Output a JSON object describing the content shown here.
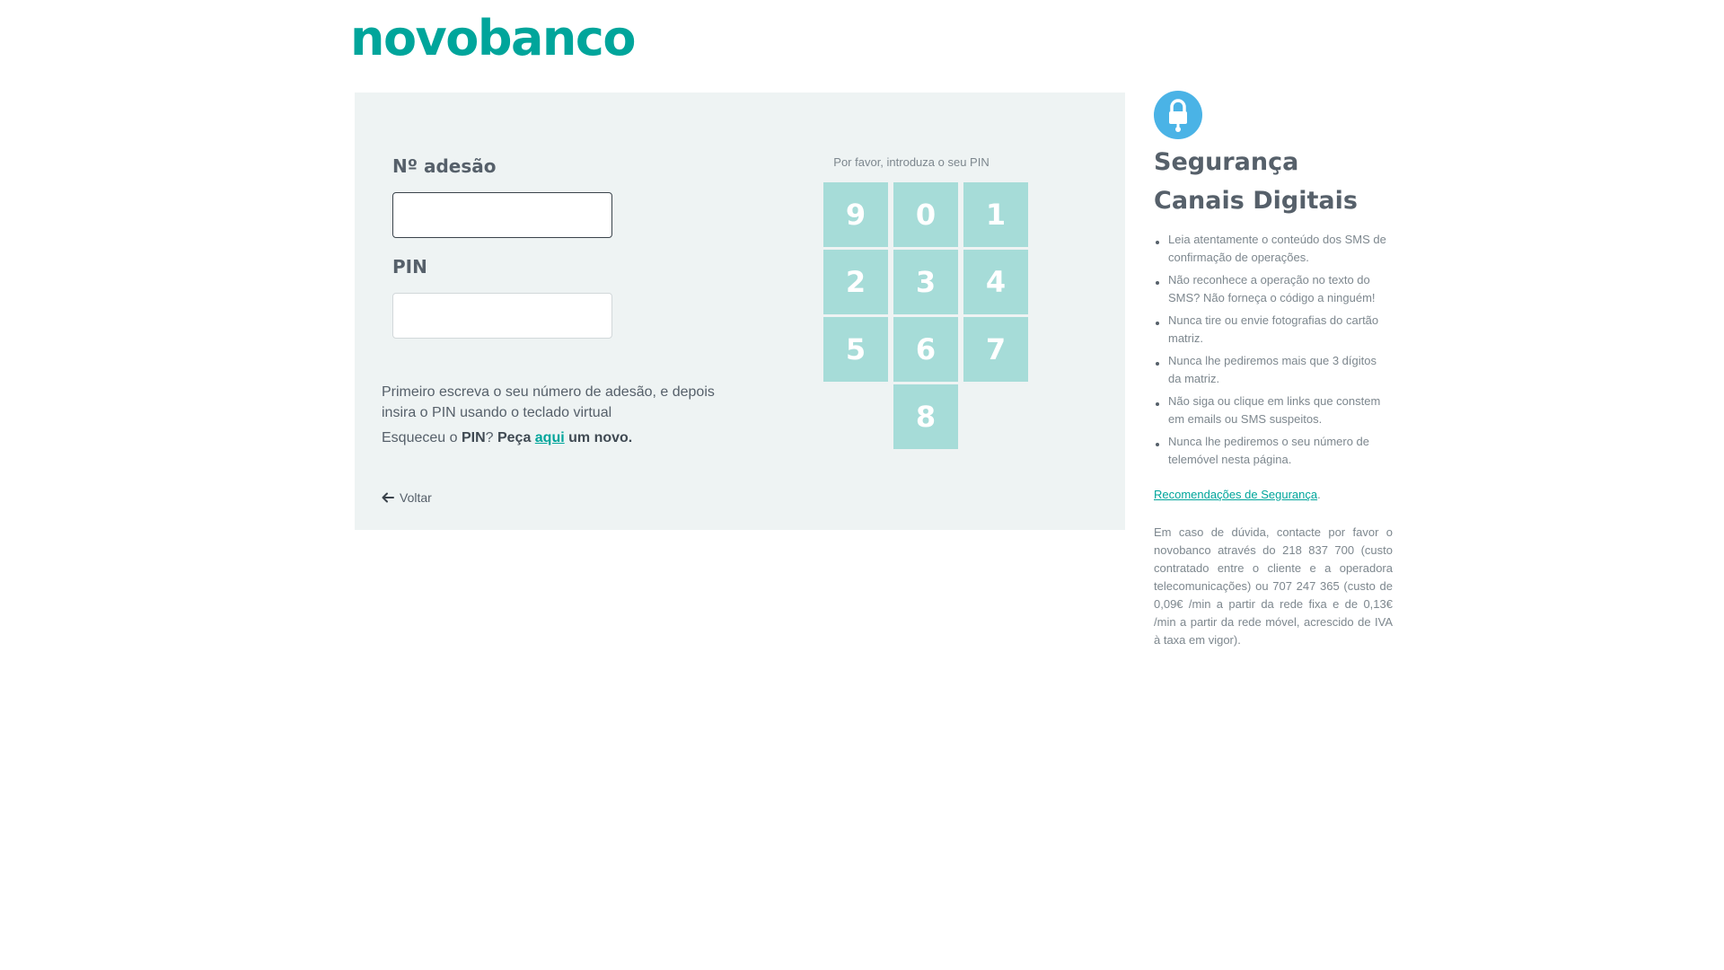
{
  "brand": {
    "logo_text": "novobanco",
    "accent_color": "#00a59b",
    "keypad_color": "#a6dcd8",
    "badge_color": "#4ab3e6",
    "panel_bg": "#eef3f3"
  },
  "login": {
    "adesao_label": "Nº adesão",
    "adesao_value": "",
    "pin_label": "PIN",
    "pin_value": "",
    "instructions": "Primeiro escreva o seu número de adesão, e depois insira o PIN usando o teclado virtual",
    "forgot_prefix": "Esqueceu o ",
    "forgot_pin": "PIN",
    "forgot_q": "? ",
    "forgot_peca": "Peça ",
    "forgot_link": "aqui",
    "forgot_suffix": " um novo.",
    "back_label": "Voltar",
    "back_icon": "arrow-left-icon"
  },
  "keypad": {
    "prompt": "Por favor, introduza o seu PIN",
    "keys": [
      "9",
      "0",
      "1",
      "2",
      "3",
      "4",
      "5",
      "6",
      "7",
      "8"
    ]
  },
  "security": {
    "icon": "lock-icon",
    "title": "Segurança Canais Digitais",
    "tips": [
      "Leia atentamente o conteúdo dos SMS de confirmação de operações.",
      "Não reconhece a operação no texto do SMS? Não forneça o código a ninguém!",
      "Nunca tire ou envie fotografias do cartão matriz.",
      "Nunca lhe pediremos mais que 3 dígitos da matriz.",
      "Não siga ou clique em links que constem em emails ou SMS suspeitos.",
      "Nunca lhe pediremos o seu número de telemóvel nesta página."
    ],
    "recommendations_link": "Recomendações de Segurança",
    "recommendations_dot": ".",
    "contact_text": "Em caso de dúvida, contacte por favor o novobanco através do 218 837 700 (custo contratado entre o cliente e a operadora telecomunicações) ou 707 247 365 (custo de 0,09€ /min a partir da rede fixa e de 0,13€ /min a partir da rede móvel, acrescido de IVA à taxa em vigor)."
  }
}
